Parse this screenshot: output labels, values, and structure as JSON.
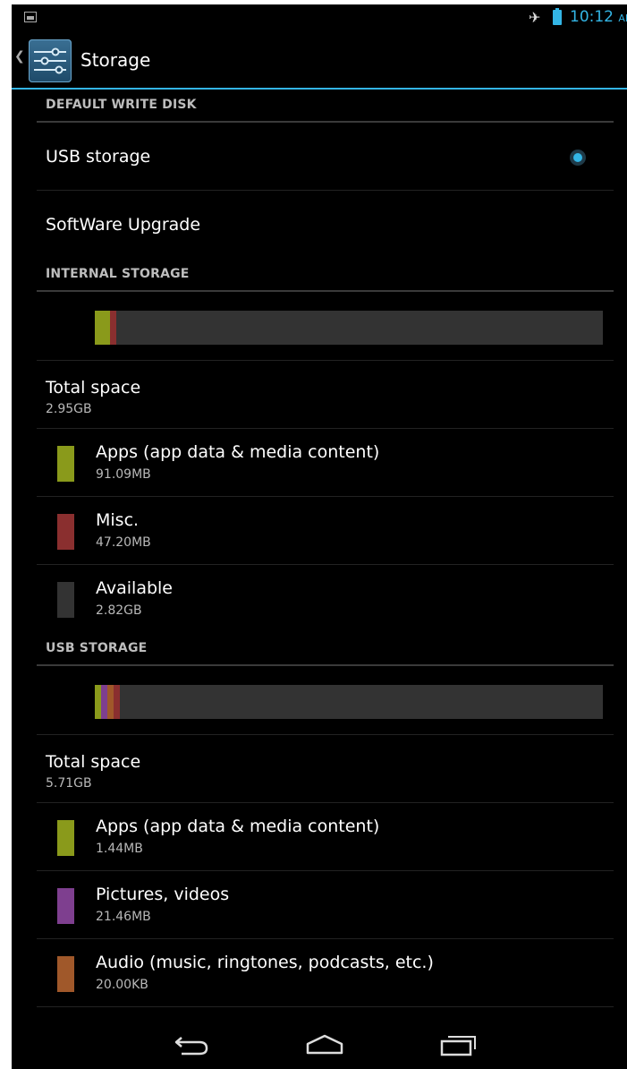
{
  "status_bar": {
    "time": "10:12",
    "ampm": "AM",
    "icons": [
      "image-notification-icon",
      "airplane-mode-icon",
      "battery-icon"
    ]
  },
  "action_bar": {
    "title": "Storage",
    "icon": "settings-sliders-icon"
  },
  "default_write_disk": {
    "header": "DEFAULT WRITE DISK",
    "options": [
      {
        "label": "USB storage",
        "selected": true
      }
    ],
    "software_upgrade": "SoftWare Upgrade"
  },
  "internal_storage": {
    "header": "INTERNAL STORAGE",
    "total_label": "Total space",
    "total_value": "2.95GB",
    "usage_fractions": {
      "apps": 0.03,
      "misc": 0.013
    },
    "items": [
      {
        "label": "Apps (app data & media content)",
        "value": "91.09MB",
        "color": "#8a9a1b"
      },
      {
        "label": "Misc.",
        "value": "47.20MB",
        "color": "#8a2f2f"
      },
      {
        "label": "Available",
        "value": "2.82GB",
        "color": "#333333"
      }
    ]
  },
  "usb_storage": {
    "header": "USB STORAGE",
    "total_label": "Total space",
    "total_value": "5.71GB",
    "usage_fractions": {
      "apps": 0.012,
      "pictures": 0.012,
      "audio": 0.012,
      "misc": 0.012
    },
    "items": [
      {
        "label": "Apps (app data & media content)",
        "value": "1.44MB",
        "color": "#8a9a1b"
      },
      {
        "label": "Pictures, videos",
        "value": "21.46MB",
        "color": "#7e3f8f"
      },
      {
        "label": "Audio (music, ringtones, podcasts, etc.)",
        "value": "20.00KB",
        "color": "#a0582a"
      }
    ]
  },
  "nav_bar": {
    "buttons": [
      "back-icon",
      "home-icon",
      "recent-apps-icon"
    ]
  }
}
